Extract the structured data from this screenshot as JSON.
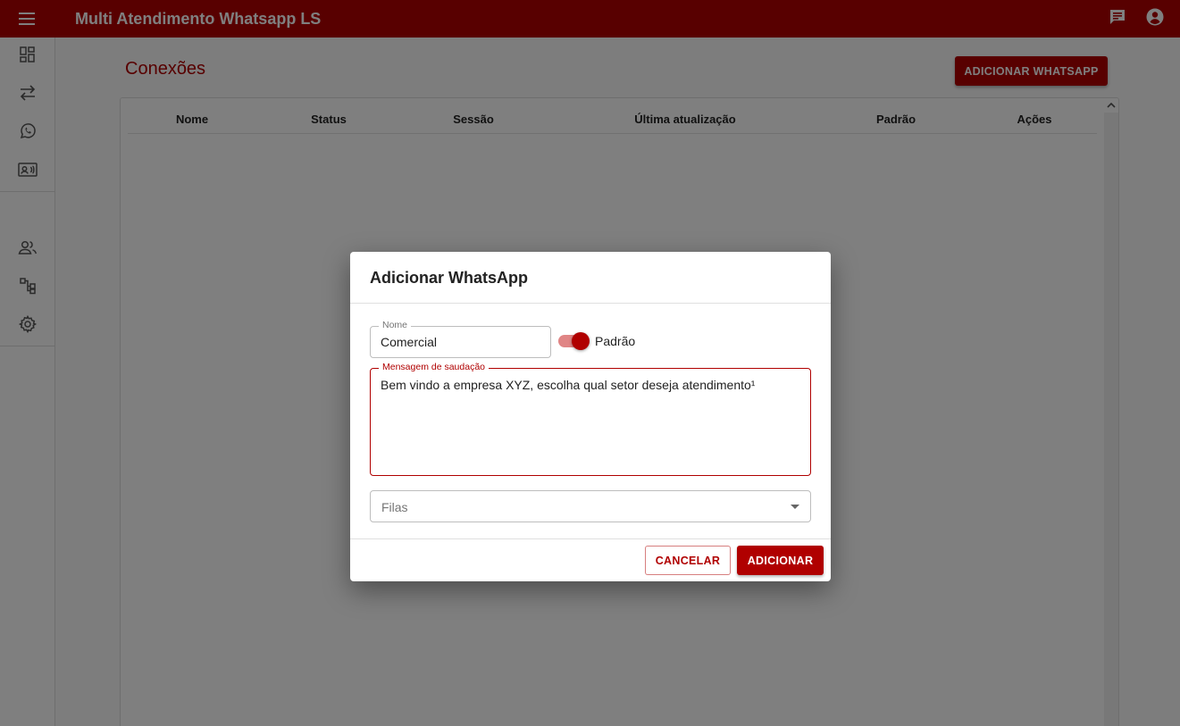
{
  "appbar": {
    "title": "Multi Atendimento Whatsapp LS",
    "menu_icon": "menu-icon",
    "right_icons": [
      "chat-icon",
      "account-circle-icon"
    ]
  },
  "sidebar": {
    "icons": [
      "dashboard-icon",
      "swap-horizontal-icon",
      "whatsapp-icon",
      "contacts-icon",
      "users-icon",
      "queues-icon",
      "settings-icon"
    ]
  },
  "page": {
    "title": "Conexões",
    "add_button": "ADICIONAR WHATSAPP"
  },
  "table": {
    "columns": [
      "Nome",
      "Status",
      "Sessão",
      "Última atualização",
      "Padrão",
      "Ações"
    ],
    "rows": []
  },
  "dialog": {
    "title": "Adicionar WhatsApp",
    "nome_label": "Nome",
    "nome_value": "Comercial",
    "switch_label": "Padrão",
    "switch_on": true,
    "mensagem_label": "Mensagem de saudação",
    "mensagem_value": "Bem vindo a empresa XYZ, escolha qual setor deseja atendimento¹",
    "filas_placeholder": "Filas",
    "cancel_button": "CANCELAR",
    "add_button": "ADICIONAR"
  },
  "colors": {
    "primary": "#b00000",
    "switch_track": "#e08585",
    "backdrop": "rgba(0,0,0,0.5)"
  }
}
